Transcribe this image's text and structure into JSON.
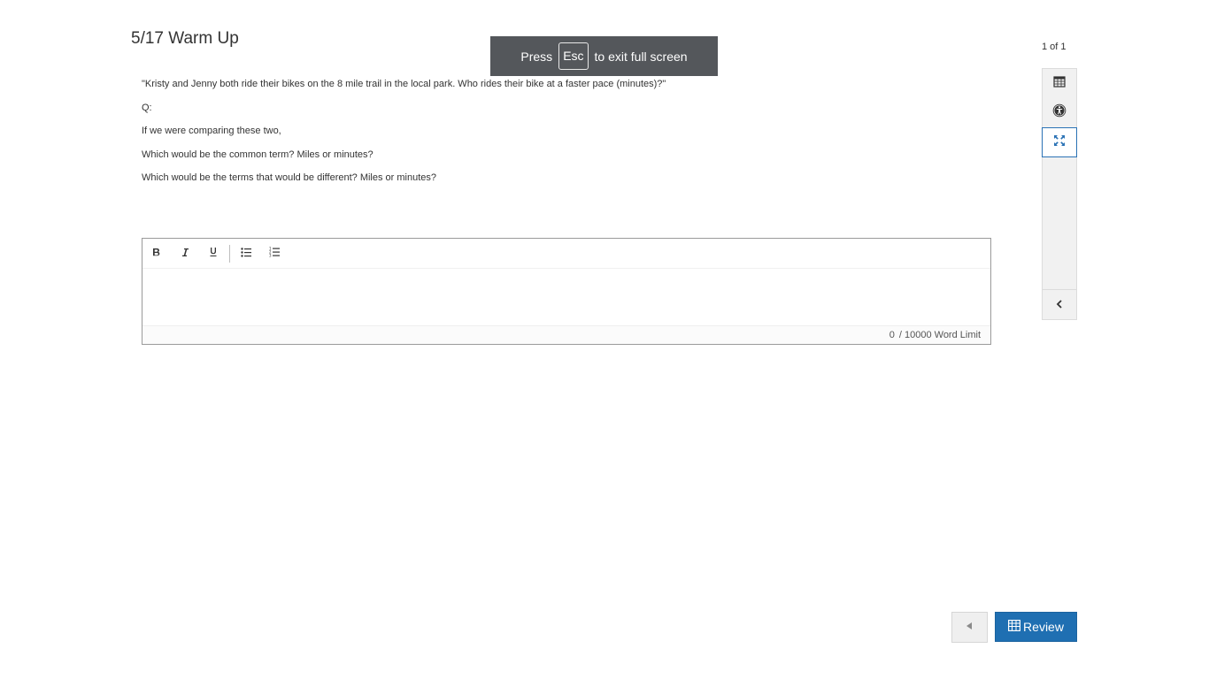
{
  "header": {
    "title": "5/17 Warm Up"
  },
  "fullscreen_notice": {
    "prefix": "Press",
    "key": "Esc",
    "suffix": "to exit full screen"
  },
  "question": {
    "lines": [
      "\"Kristy and Jenny both ride their bikes on the 8 mile trail in the local park. Who rides their bike at a faster pace (minutes)?\"",
      "Q:",
      "If we were comparing these two,",
      "Which would be the common term? Miles or minutes?",
      "Which would be the terms that would be different? Miles or minutes?"
    ]
  },
  "editor": {
    "toolbar": {
      "bold_icon": "bold-icon",
      "italic_icon": "italic-icon",
      "underline_icon": "underline-icon",
      "bulleted_list_icon": "bulleted-list-icon",
      "numbered_list_icon": "numbered-list-icon"
    },
    "content": "",
    "word_count": "0",
    "word_limit_label": "/ 10000 Word Limit"
  },
  "side_toolbar": {
    "counter": "1 of 1",
    "items": [
      {
        "icon": "calendar-icon"
      },
      {
        "icon": "accessibility-icon"
      },
      {
        "icon": "expand-icon",
        "active": true
      }
    ],
    "collapse_icon": "chevron-left-icon"
  },
  "footer": {
    "prev_icon": "triangle-left-icon",
    "review_label": "Review",
    "review_icon": "table-icon"
  },
  "colors": {
    "accent": "#1f6fb2",
    "notice_bg": "#54575b",
    "sidebar_bg": "#f1f1f1"
  }
}
